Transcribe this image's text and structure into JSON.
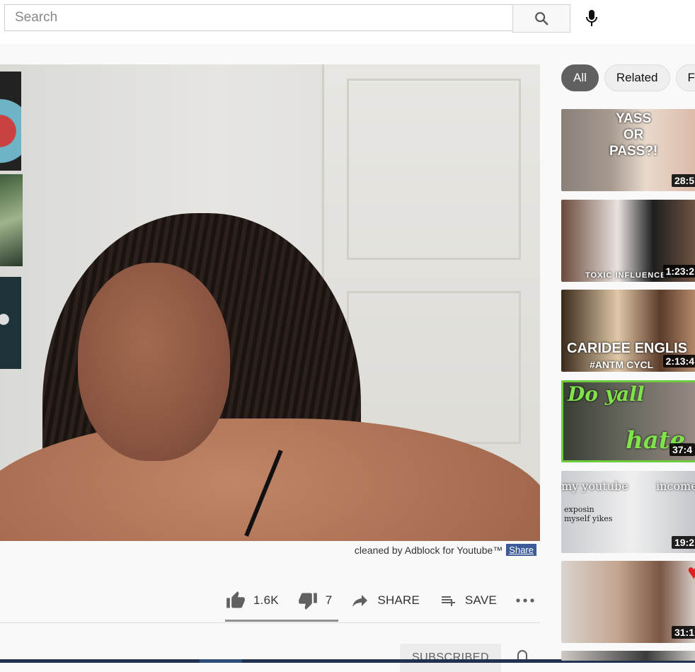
{
  "search": {
    "placeholder": "Search"
  },
  "icons": {
    "search": "search-icon",
    "mic": "mic-icon",
    "like": "thumbs-up-icon",
    "dislike": "thumbs-down-icon",
    "share": "share-arrow-icon",
    "save": "playlist-add-icon",
    "more": "more-horizontal-icon",
    "bell": "bell-icon",
    "youtube": "youtube-play-icon"
  },
  "colors": {
    "accent_blue": "#3d5a99",
    "yt_red": "#d63131",
    "chip_active": "#606060"
  },
  "adblock": {
    "credit": "cleaned by Adblock for Youtube™",
    "share_label": "Share"
  },
  "actions": {
    "likes": "1.6K",
    "dislikes": "7",
    "share_label": "SHARE",
    "save_label": "SAVE",
    "like_ratio": 0.996
  },
  "channel": {
    "subscribed_label": "SUBSCRIBED"
  },
  "chips": [
    "All",
    "Related",
    "F"
  ],
  "related": [
    {
      "overlay": "YASS\nOR\nPASS?!",
      "duration": "28:5"
    },
    {
      "overlay": "TOXIC INFLUENCER",
      "duration": "1:23:2"
    },
    {
      "overlay": "CARIDEE ENGLIS",
      "overlay2": "#ANTM CYCL",
      "duration": "2:13:4"
    },
    {
      "overlay": "Do yall",
      "overlay2": "hate",
      "duration": "37:4"
    },
    {
      "overlay": "my youtube",
      "overlay2": "income",
      "overlay3": "exposin myself yikes",
      "duration": "19:2"
    },
    {
      "overlay": "",
      "duration": "31:1"
    }
  ]
}
